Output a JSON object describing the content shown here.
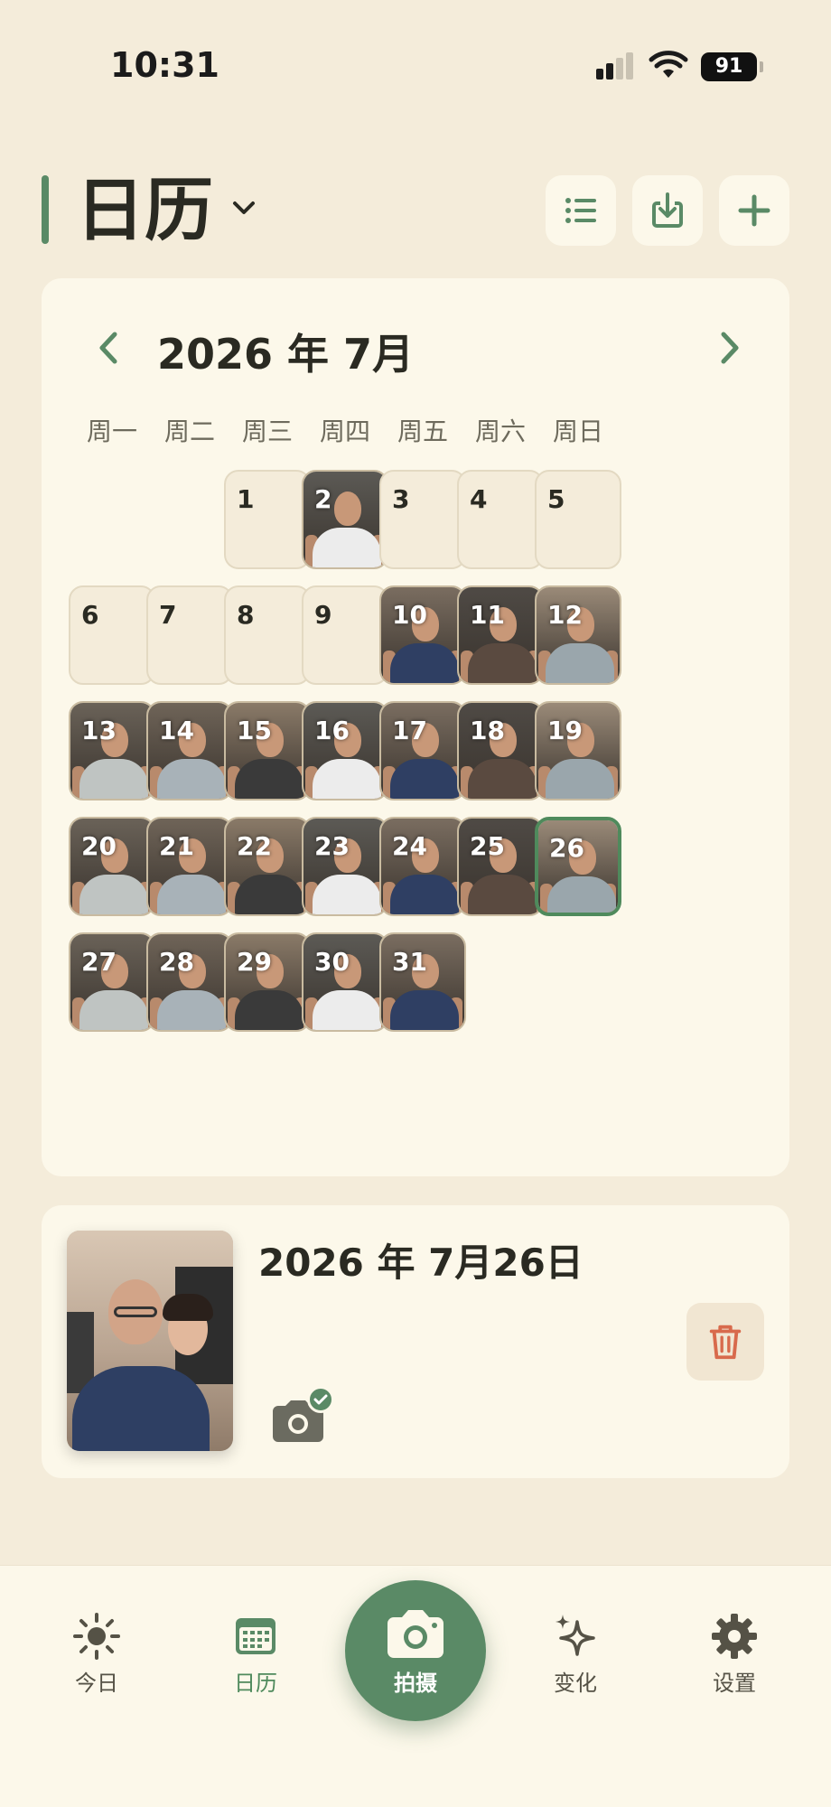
{
  "status_bar": {
    "time": "10:31",
    "battery": "91"
  },
  "header": {
    "title": "日历",
    "title_chevron_icon": "chevron-down-icon",
    "buttons": [
      {
        "name": "list-view-button",
        "icon": "list-icon"
      },
      {
        "name": "export-button",
        "icon": "download-icon"
      },
      {
        "name": "add-button",
        "icon": "plus-icon"
      }
    ]
  },
  "calendar": {
    "month_label": "2026 年 7月",
    "prev_icon": "chevron-left-icon",
    "next_icon": "chevron-right-icon",
    "weekdays": [
      "周一",
      "周二",
      "周三",
      "周四",
      "周五",
      "周六",
      "周日"
    ],
    "first_weekday_index": 2,
    "days_in_month": 31,
    "photo_days": [
      2,
      10,
      11,
      12,
      13,
      14,
      15,
      16,
      17,
      18,
      19,
      20,
      21,
      22,
      23,
      24,
      25,
      26,
      27,
      28,
      29,
      30,
      31
    ],
    "selected_day": 26,
    "accent_color": "#5a8a66"
  },
  "detail": {
    "date": "2026 年 7月26日",
    "camera_icon": "camera-check-icon",
    "delete_icon": "trash-icon"
  },
  "tabbar": {
    "tabs": [
      {
        "label": "今日",
        "icon": "sun-icon"
      },
      {
        "label": "日历",
        "icon": "calendar-icon",
        "active": true
      },
      {
        "label": "拍摄",
        "icon": "camera-icon"
      },
      {
        "label": "变化",
        "icon": "sparkle-icon"
      },
      {
        "label": "设置",
        "icon": "gear-icon"
      }
    ]
  }
}
